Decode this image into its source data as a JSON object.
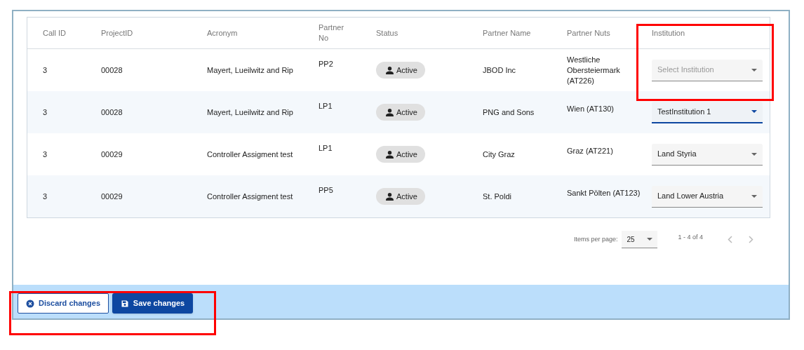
{
  "table": {
    "columns": [
      {
        "label": "Call ID"
      },
      {
        "label": "ProjectID"
      },
      {
        "label": "Acronym"
      },
      {
        "label": "Partner No"
      },
      {
        "label": "Status"
      },
      {
        "label": "Partner Name"
      },
      {
        "label": "Partner Nuts"
      },
      {
        "label": "Institution",
        "highlighted": true
      }
    ],
    "rows": [
      {
        "call_id": "3",
        "project_id": "00028",
        "acronym": "Mayert, Lueilwitz and Rip",
        "partner_no": "PP2",
        "status": "Active",
        "partner_name": "JBOD Inc",
        "partner_nuts": "Westliche Obersteiermark (AT226)",
        "institution": {
          "placeholder": "Select Institution",
          "focused": false
        }
      },
      {
        "call_id": "3",
        "project_id": "00028",
        "acronym": "Mayert, Lueilwitz and Rip",
        "partner_no": "LP1",
        "status": "Active",
        "partner_name": "PNG and Sons",
        "partner_nuts": "Wien (AT130)",
        "institution": {
          "value": "TestInstitution 1",
          "focused": true
        }
      },
      {
        "call_id": "3",
        "project_id": "00029",
        "acronym": "Controller Assigment test",
        "partner_no": "LP1",
        "status": "Active",
        "partner_name": "City Graz",
        "partner_nuts": "Graz (AT221)",
        "institution": {
          "value": "Land Styria",
          "focused": false
        }
      },
      {
        "call_id": "3",
        "project_id": "00029",
        "acronym": "Controller Assigment test",
        "partner_no": "PP5",
        "status": "Active",
        "partner_name": "St. Poldi",
        "partner_nuts": "Sankt Pölten (AT123)",
        "institution": {
          "value": "Land Lower Austria",
          "focused": false
        }
      }
    ]
  },
  "paginator": {
    "items_per_page_label": "Items per page:",
    "page_size": "25",
    "range": "1 - 4 of 4"
  },
  "actions": {
    "highlighted": true,
    "buttons": [
      {
        "kind": "secondary",
        "label": "Discard changes"
      },
      {
        "kind": "primary",
        "label": "Save changes"
      }
    ]
  }
}
